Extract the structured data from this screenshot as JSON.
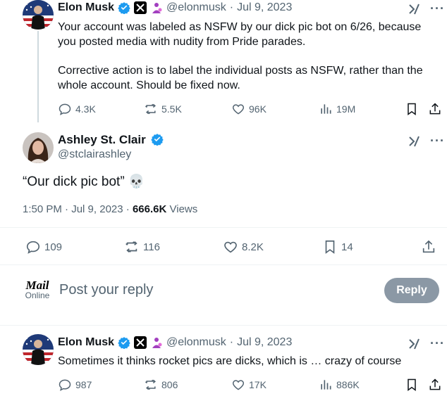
{
  "tweet1": {
    "name": "Elon Musk",
    "handle": "@elonmusk",
    "sep": "·",
    "date": "Jul 9, 2023",
    "para1": "Your account was labeled as NSFW by our dick pic bot on 6/26, because you posted media with nudity from Pride parades.",
    "para2": "Corrective action is to label the individual posts as NSFW, rather than the whole account. Should be fixed now.",
    "replies": "4.3K",
    "reposts": "5.5K",
    "likes": "96K",
    "views": "19M"
  },
  "main": {
    "name": "Ashley St. Clair",
    "handle": "@stclairashley",
    "text": "“Our dick pic bot” 💀",
    "time": "1:50 PM",
    "sep": "·",
    "date": "Jul 9, 2023",
    "sep2": "·",
    "views_count": "666.6K",
    "views_label": "Views",
    "replies": "109",
    "reposts": "116",
    "likes": "8.2K",
    "bookmarks": "14"
  },
  "compose": {
    "logo_top": "Mail",
    "logo_bottom": "Online",
    "placeholder": "Post your reply",
    "reply_button": "Reply"
  },
  "tweet3": {
    "name": "Elon Musk",
    "handle": "@elonmusk",
    "sep": "·",
    "date": "Jul 9, 2023",
    "text": "Sometimes it thinks rocket pics are dicks, which is … crazy of course",
    "replies": "987",
    "reposts": "806",
    "likes": "17K",
    "views": "886K"
  },
  "colors": {
    "verified": "#1d9bf0",
    "muted": "#536471",
    "reply_button_bg": "#8b98a5"
  }
}
